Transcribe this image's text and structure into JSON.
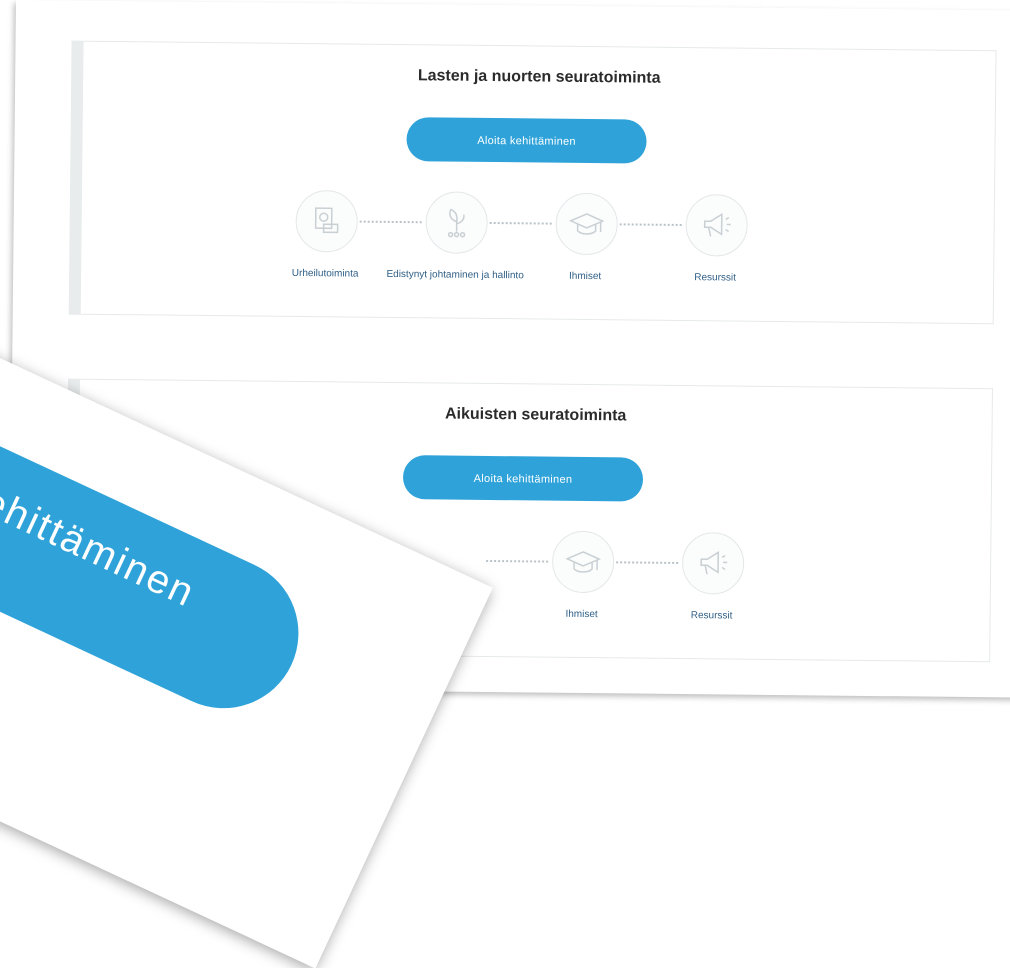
{
  "cards": [
    {
      "title": "Lasten ja nuorten seuratoiminta",
      "button": "Aloita kehittäminen",
      "steps": [
        {
          "label": "Urheilutoiminta",
          "icon": "document-icon"
        },
        {
          "label": "Edistynyt johtaminen ja hallinto",
          "icon": "plant-icon"
        },
        {
          "label": "Ihmiset",
          "icon": "graduation-cap-icon"
        },
        {
          "label": "Resurssit",
          "icon": "megaphone-icon"
        }
      ]
    },
    {
      "title": "Aikuisten seuratoiminta",
      "button": "Aloita kehittäminen",
      "steps": [
        {
          "label": "Ihmiset",
          "icon": "graduation-cap-icon"
        },
        {
          "label": "Resurssit",
          "icon": "megaphone-icon"
        }
      ]
    }
  ],
  "overlay": {
    "text": "ta kehittäminen"
  },
  "colors": {
    "accent": "#2fa3d9",
    "label": "#2f5f86",
    "icon": "#c9d0d4"
  }
}
